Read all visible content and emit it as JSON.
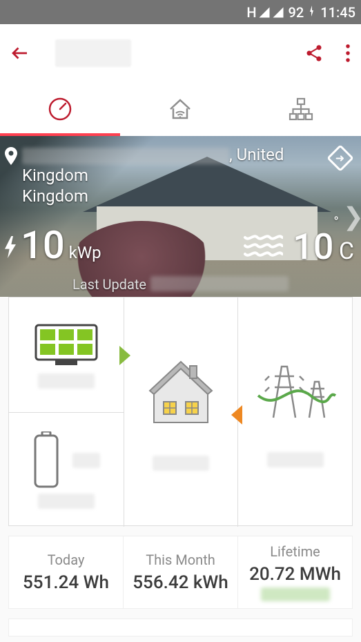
{
  "statusbar": {
    "network_type": "H",
    "battery_pct": "92",
    "time": "11:45"
  },
  "appbar": {
    "title": ""
  },
  "tabs": {
    "active_index": 0
  },
  "hero": {
    "location_prefix": "",
    "location_country": ", United Kingdom",
    "system_power_value": "10",
    "system_power_unit": "kWp",
    "temperature_value": "10",
    "temperature_degree": "°",
    "temperature_unit": "C",
    "last_update_label": "Last Update"
  },
  "diagram": {
    "solar_value": "",
    "battery_pct": "",
    "battery_value": "",
    "house_value": "",
    "grid_value": ""
  },
  "stats": {
    "today_label": "Today",
    "today_value": "551.24  Wh",
    "month_label": "This Month",
    "month_value": "556.42 kWh",
    "lifetime_label": "Lifetime",
    "lifetime_value": "20.72 MWh",
    "lifetime_money": ""
  }
}
